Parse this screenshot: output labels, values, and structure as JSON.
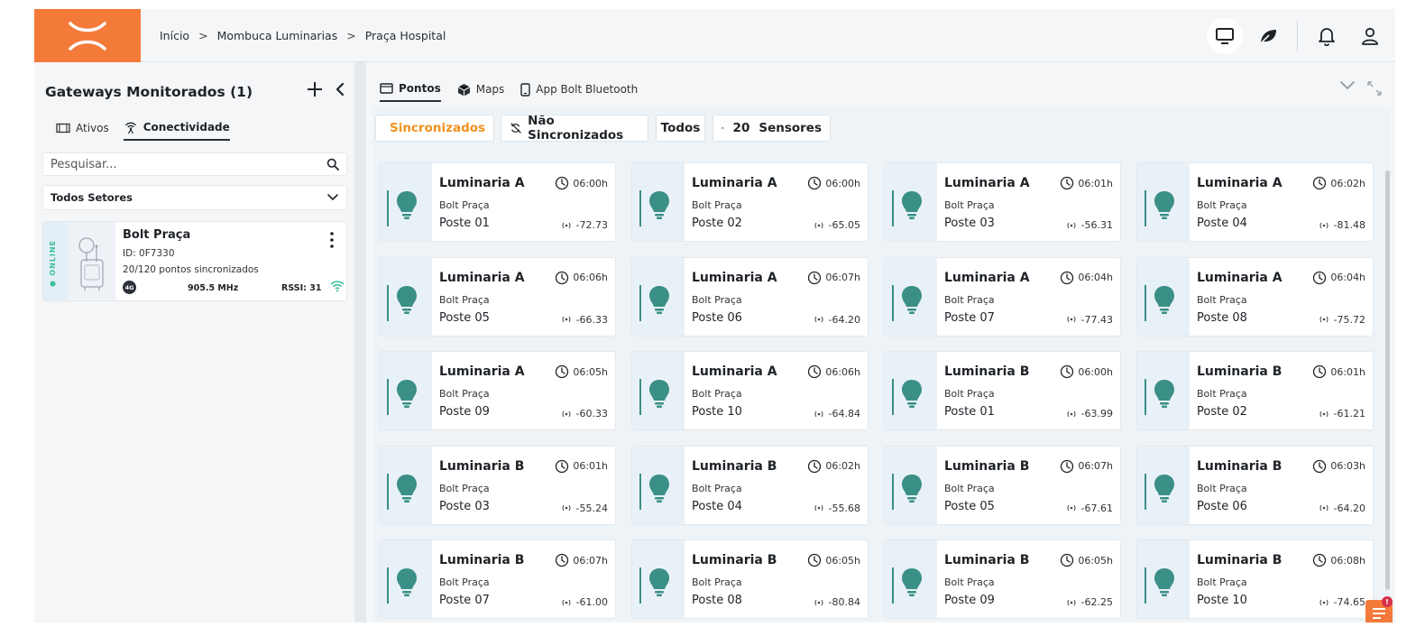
{
  "header": {
    "breadcrumb": [
      "Início",
      "Mombuca Luminarias",
      "Praça Hospital"
    ],
    "separator": ">"
  },
  "sidebar": {
    "title": "Gateways Monitorados (1)",
    "tabs": [
      {
        "label": "Ativos",
        "active": false
      },
      {
        "label": "Conectividade",
        "active": true
      }
    ],
    "search_placeholder": "Pesquisar...",
    "sector": "Todos Setores",
    "gateway": {
      "status": "ONLINE",
      "name": "Bolt Praça",
      "id": "ID: 0F7330",
      "sync": "20/120 pontos sincronizados",
      "network": "4G",
      "frequency": "905.5 MHz",
      "rssi": "RSSI: 31"
    }
  },
  "main": {
    "tabs": [
      {
        "label": "Pontos",
        "active": true
      },
      {
        "label": "Maps",
        "active": false
      },
      {
        "label": "App Bolt Bluetooth",
        "active": false
      }
    ],
    "filters": {
      "synced": "Sincronizados",
      "not_synced": "Não Sincronizados",
      "all": "Todos",
      "count": "20",
      "sensors": "Sensores"
    },
    "cards": [
      {
        "title": "Luminaria A",
        "time": "06:00h",
        "sub": "Bolt Praça",
        "poste": "Poste 01",
        "rssi": "-72.73"
      },
      {
        "title": "Luminaria A",
        "time": "06:00h",
        "sub": "Bolt Praça",
        "poste": "Poste 02",
        "rssi": "-65.05"
      },
      {
        "title": "Luminaria A",
        "time": "06:01h",
        "sub": "Bolt Praça",
        "poste": "Poste 03",
        "rssi": "-56.31"
      },
      {
        "title": "Luminaria A",
        "time": "06:02h",
        "sub": "Bolt Praça",
        "poste": "Poste 04",
        "rssi": "-81.48"
      },
      {
        "title": "Luminaria A",
        "time": "06:06h",
        "sub": "Bolt Praça",
        "poste": "Poste 05",
        "rssi": "-66.33"
      },
      {
        "title": "Luminaria A",
        "time": "06:07h",
        "sub": "Bolt Praça",
        "poste": "Poste 06",
        "rssi": "-64.20"
      },
      {
        "title": "Luminaria A",
        "time": "06:04h",
        "sub": "Bolt Praça",
        "poste": "Poste 07",
        "rssi": "-77.43"
      },
      {
        "title": "Luminaria A",
        "time": "06:04h",
        "sub": "Bolt Praça",
        "poste": "Poste 08",
        "rssi": "-75.72"
      },
      {
        "title": "Luminaria A",
        "time": "06:05h",
        "sub": "Bolt Praça",
        "poste": "Poste 09",
        "rssi": "-60.33"
      },
      {
        "title": "Luminaria A",
        "time": "06:06h",
        "sub": "Bolt Praça",
        "poste": "Poste 10",
        "rssi": "-64.84"
      },
      {
        "title": "Luminaria B",
        "time": "06:00h",
        "sub": "Bolt Praça",
        "poste": "Poste 01",
        "rssi": "-63.99"
      },
      {
        "title": "Luminaria B",
        "time": "06:01h",
        "sub": "Bolt Praça",
        "poste": "Poste 02",
        "rssi": "-61.21"
      },
      {
        "title": "Luminaria B",
        "time": "06:01h",
        "sub": "Bolt Praça",
        "poste": "Poste 03",
        "rssi": "-55.24"
      },
      {
        "title": "Luminaria B",
        "time": "06:02h",
        "sub": "Bolt Praça",
        "poste": "Poste 04",
        "rssi": "-55.68"
      },
      {
        "title": "Luminaria B",
        "time": "06:07h",
        "sub": "Bolt Praça",
        "poste": "Poste 05",
        "rssi": "-67.61"
      },
      {
        "title": "Luminaria B",
        "time": "06:03h",
        "sub": "Bolt Praça",
        "poste": "Poste 06",
        "rssi": "-64.20"
      },
      {
        "title": "Luminaria B",
        "time": "06:07h",
        "sub": "Bolt Praça",
        "poste": "Poste 07",
        "rssi": "-61.00"
      },
      {
        "title": "Luminaria B",
        "time": "06:05h",
        "sub": "Bolt Praça",
        "poste": "Poste 08",
        "rssi": "-80.84"
      },
      {
        "title": "Luminaria B",
        "time": "06:05h",
        "sub": "Bolt Praça",
        "poste": "Poste 09",
        "rssi": "-62.25"
      },
      {
        "title": "Luminaria B",
        "time": "06:08h",
        "sub": "Bolt Praça",
        "poste": "Poste 10",
        "rssi": "-74.65"
      }
    ]
  },
  "chat": {
    "badge": "!"
  },
  "colors": {
    "brand": "#f47a3a",
    "synced": "#f2911e",
    "bulb": "#3a8f86",
    "online": "#3bbf9a",
    "badge": "#d6304a"
  },
  "icons": {
    "header": [
      "monitor-icon",
      "leaf-icon",
      "bell-icon",
      "user-icon"
    ],
    "card": [
      "bulb-icon",
      "clock-icon",
      "signal-icon"
    ]
  }
}
